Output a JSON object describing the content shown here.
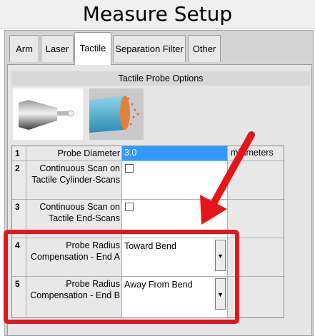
{
  "window": {
    "title": "Measure Setup"
  },
  "tabs": [
    {
      "label": "Arm"
    },
    {
      "label": "Laser"
    },
    {
      "label": "Tactile",
      "active": true
    },
    {
      "label": "Separation Filter"
    },
    {
      "label": "Other"
    }
  ],
  "section": {
    "header": "Tactile Probe Options"
  },
  "images": [
    {
      "icon": "probe-tip-icon"
    },
    {
      "icon": "cylinder-scan-icon"
    }
  ],
  "grid": {
    "rows": [
      {
        "num": "1",
        "label": "Probe Diameter",
        "value": "3.0",
        "unit": "millimeters",
        "type": "text"
      },
      {
        "num": "2",
        "label": "Continuous Scan on Tactile Cylinder-Scans",
        "checked": false,
        "type": "checkbox"
      },
      {
        "num": "3",
        "label": "Continuous Scan on Tactile End-Scans",
        "checked": false,
        "type": "checkbox"
      },
      {
        "num": "4",
        "label": "Probe Radius Compensation - End A",
        "value": "Toward Bend",
        "type": "dropdown"
      },
      {
        "num": "5",
        "label": "Probe Radius Compensation - End B",
        "value": "Away From Bend",
        "type": "dropdown"
      }
    ]
  },
  "annotation": {
    "highlight_color": "#e8141b"
  }
}
